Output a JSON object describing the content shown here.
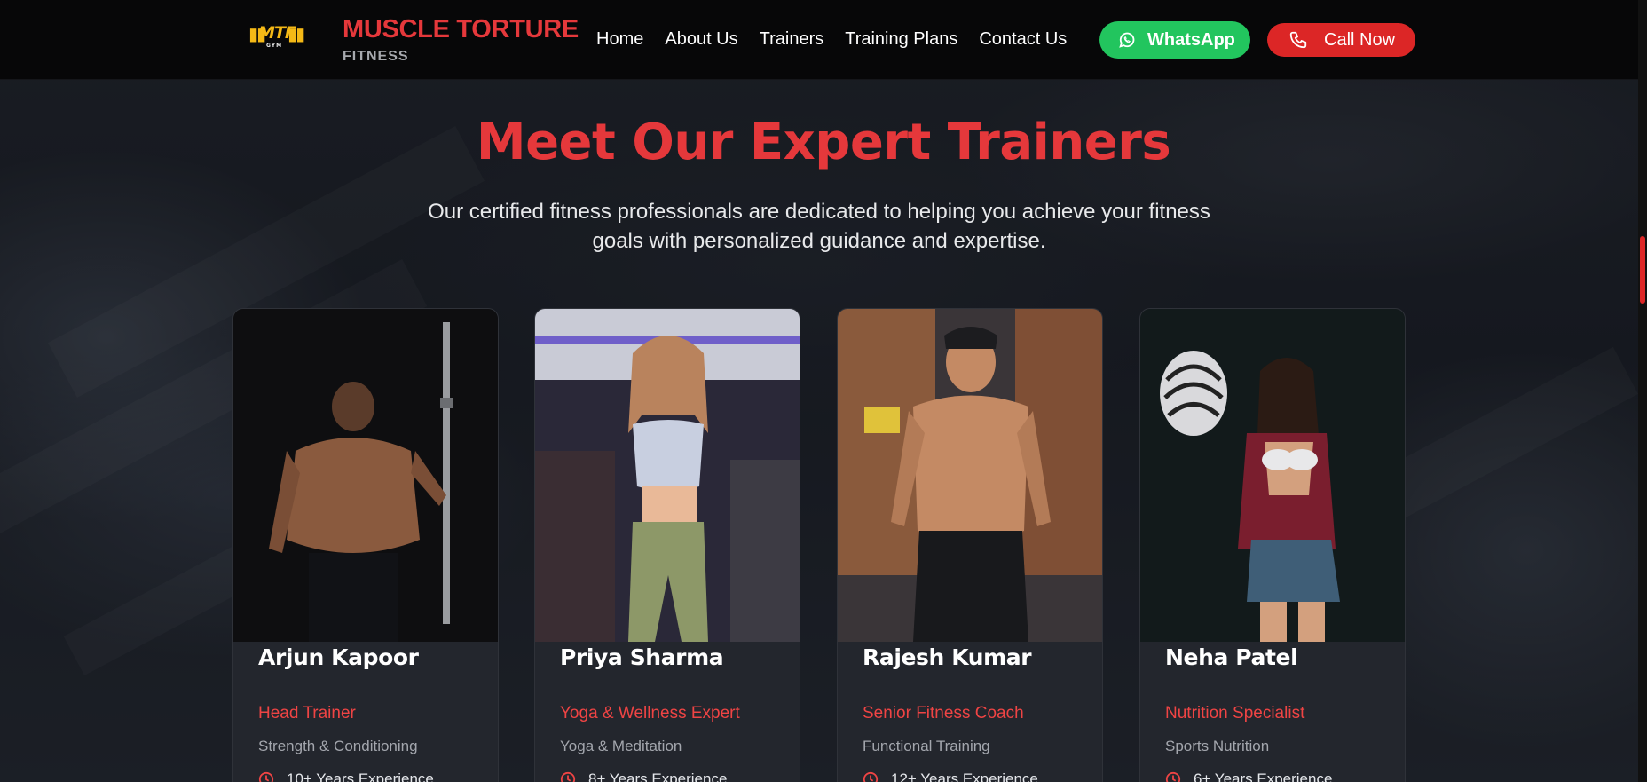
{
  "header": {
    "logo_text": "MTF",
    "logo_sub": "GYM",
    "brand_name": "MUSCLE TORTURE",
    "brand_sub": "FITNESS",
    "nav": [
      "Home",
      "About Us",
      "Trainers",
      "Training Plans",
      "Contact Us"
    ],
    "whatsapp_label": "WhatsApp",
    "call_label": "Call Now"
  },
  "section": {
    "title": "Meet Our Expert Trainers",
    "subtitle": "Our certified fitness professionals are dedicated to helping you achieve your fitness goals with personalized guidance and expertise."
  },
  "trainers": [
    {
      "name": "Arjun Kapoor",
      "role": "Head Trainer",
      "specialty": "Strength & Conditioning",
      "experience": "10+ Years Experience"
    },
    {
      "name": "Priya Sharma",
      "role": "Yoga & Wellness Expert",
      "specialty": "Yoga & Meditation",
      "experience": "8+ Years Experience"
    },
    {
      "name": "Rajesh Kumar",
      "role": "Senior Fitness Coach",
      "specialty": "Functional Training",
      "experience": "12+ Years Experience"
    },
    {
      "name": "Neha Patel",
      "role": "Nutrition Specialist",
      "specialty": "Sports Nutrition",
      "experience": "6+ Years Experience"
    }
  ],
  "colors": {
    "accent_red": "#e5383b",
    "whatsapp_green": "#22c55e",
    "call_red": "#dc2626",
    "logo_yellow": "#f5b916"
  },
  "icons": {
    "whatsapp": "whatsapp-icon",
    "call": "phone-icon",
    "experience": "clock-icon"
  }
}
